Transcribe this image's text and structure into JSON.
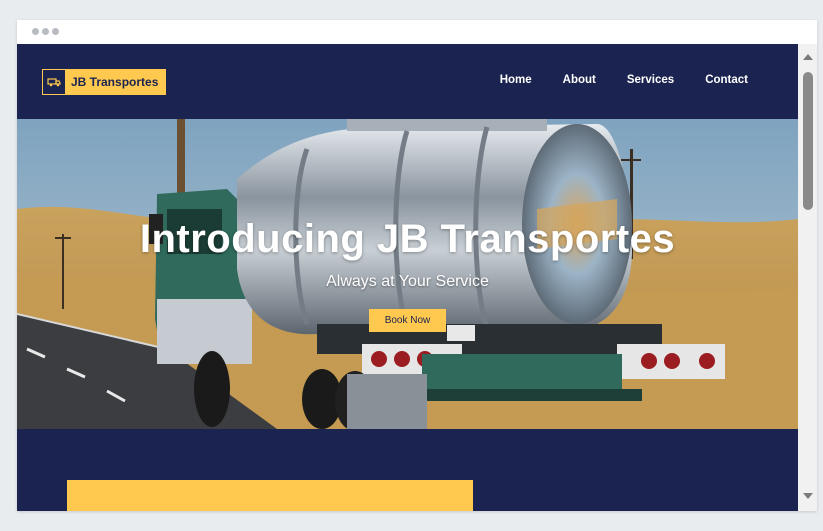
{
  "browser": {
    "controls": [
      "dot",
      "dot",
      "dot"
    ]
  },
  "site": {
    "brand": "JB Transportes",
    "brand_icon": "truck-icon",
    "nav": [
      {
        "label": "Home"
      },
      {
        "label": "About"
      },
      {
        "label": "Services"
      },
      {
        "label": "Contact"
      }
    ]
  },
  "hero": {
    "title": "Introducing JB Transportes",
    "subtitle": "Always at Your Service",
    "button_label": "Book Now",
    "image": "tanker-truck-photo"
  },
  "colors": {
    "navy": "#1b2451",
    "accent_yellow": "#ffc84e",
    "text_white": "#ffffff"
  }
}
